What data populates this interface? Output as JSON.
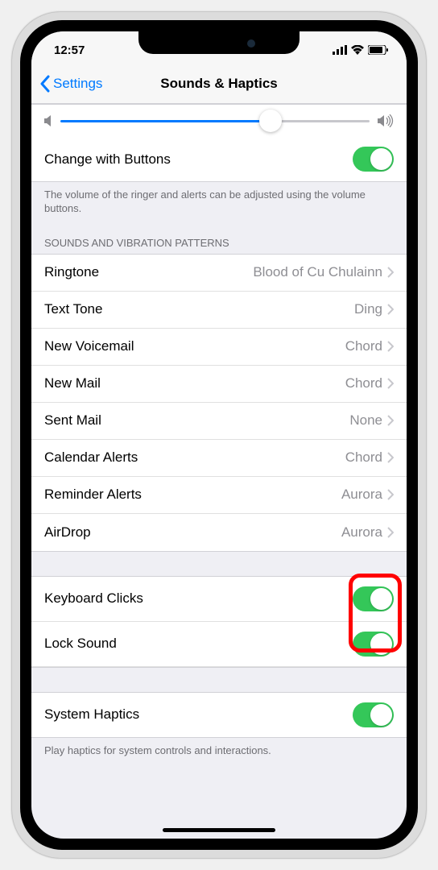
{
  "status": {
    "time": "12:57"
  },
  "nav": {
    "back": "Settings",
    "title": "Sounds & Haptics"
  },
  "changeWithButtons": {
    "label": "Change with Buttons"
  },
  "volumeFooter": "The volume of the ringer and alerts can be adjusted using the volume buttons.",
  "patternsHeader": "SOUNDS AND VIBRATION PATTERNS",
  "soundRows": [
    {
      "label": "Ringtone",
      "value": "Blood of Cu Chulainn"
    },
    {
      "label": "Text Tone",
      "value": "Ding"
    },
    {
      "label": "New Voicemail",
      "value": "Chord"
    },
    {
      "label": "New Mail",
      "value": "Chord"
    },
    {
      "label": "Sent Mail",
      "value": "None"
    },
    {
      "label": "Calendar Alerts",
      "value": "Chord"
    },
    {
      "label": "Reminder Alerts",
      "value": "Aurora"
    },
    {
      "label": "AirDrop",
      "value": "Aurora"
    }
  ],
  "toggleRows": [
    {
      "label": "Keyboard Clicks"
    },
    {
      "label": "Lock Sound"
    }
  ],
  "systemHaptics": {
    "label": "System Haptics",
    "footer": "Play haptics for system controls and interactions."
  }
}
